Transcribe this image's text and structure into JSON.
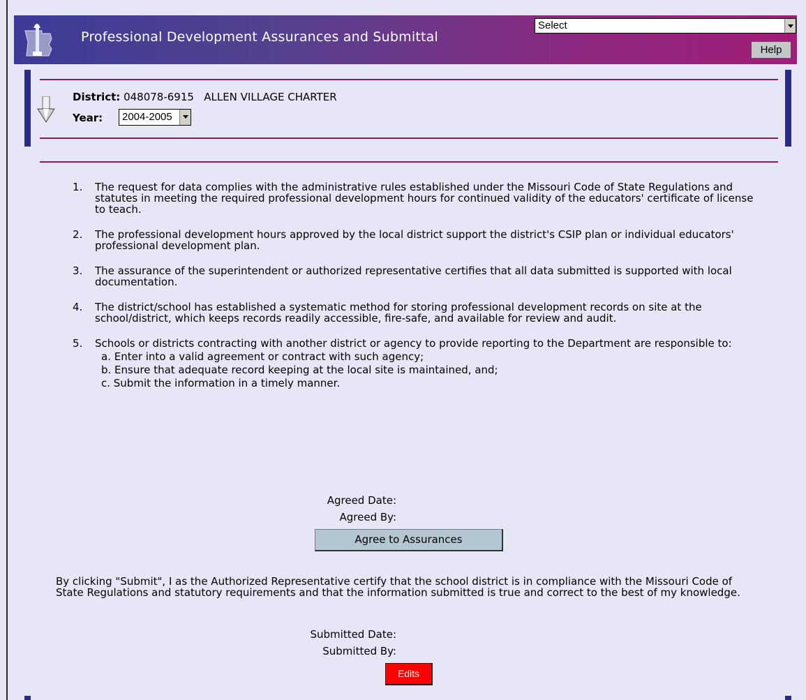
{
  "header": {
    "title": "Professional Development Assurances and Submittal",
    "nav_select_value": "Select",
    "help_label": "Help"
  },
  "district": {
    "label": "District:",
    "value": "048078-6915   ALLEN VILLAGE CHARTER"
  },
  "year": {
    "label": "Year:",
    "value": "2004-2005"
  },
  "assurances": [
    {
      "num": "1.",
      "text": "The request for data complies with the administrative rules established under the Missouri Code of State Regulations and statutes in meeting the required professional development hours for continued validity of the educators' certificate of license to teach."
    },
    {
      "num": "2.",
      "text": "The professional development hours approved by the local district support the district's CSIP plan or individual educators' professional development plan."
    },
    {
      "num": "3.",
      "text": "The assurance of the superintendent or authorized representative certifies that all data submitted is supported with local documentation."
    },
    {
      "num": "4.",
      "text": "The district/school has established a systematic method for storing professional development records on site at the school/district, which keeps records readily accessible, fire-safe, and available for review and audit."
    },
    {
      "num": "5.",
      "text": "Schools or districts contracting with another district or agency to provide reporting to the Department are responsible to:"
    }
  ],
  "sub_items": [
    "a. Enter into a valid agreement or contract with such agency;",
    "b. Ensure that adequate record keeping at the local site is maintained, and;",
    "c. Submit the information in a timely manner."
  ],
  "agreement": {
    "date_label": "Agreed Date:",
    "by_label": "Agreed By:",
    "button_label": "Agree to Assurances"
  },
  "certification_text": "By clicking \"Submit\", I as the Authorized Representative certify that the school district is in compliance with the Missouri Code of State Regulations and statutory requirements and that the information submitted is true and correct to the best of my knowledge.",
  "submission": {
    "date_label": "Submitted Date:",
    "by_label": "Submitted By:",
    "edits_label": "Edits"
  },
  "colors": {
    "background": "#e6e6f7",
    "banner_start": "#3c3c96",
    "banner_end": "#a21c78",
    "rule": "#8b1a60",
    "side_bar": "#2a2a8a",
    "agree_button": "#b4c6d2",
    "edits_button": "#ff0000"
  },
  "icons": {
    "logo": "missouri-torch-logo-icon",
    "collapse": "down-arrow-icon"
  }
}
